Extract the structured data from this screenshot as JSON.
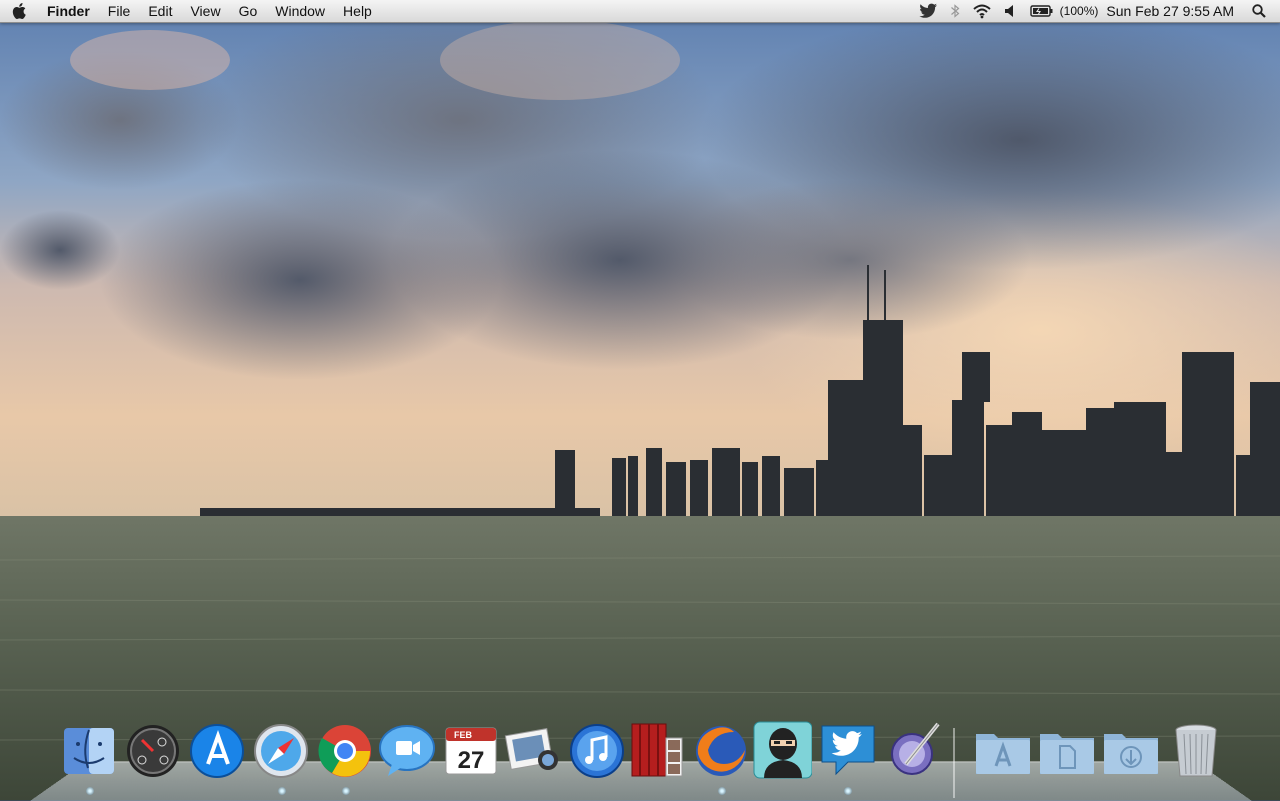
{
  "menubar": {
    "app_name": "Finder",
    "menus": [
      "File",
      "Edit",
      "View",
      "Go",
      "Window",
      "Help"
    ],
    "battery_percent": "(100%)",
    "clock": "Sun Feb 27  9:55 AM",
    "status_icons": [
      "twitter-bird-icon",
      "bluetooth-icon",
      "wifi-icon",
      "volume-icon",
      "battery-icon",
      "spotlight-icon"
    ]
  },
  "desktop": {
    "wallpaper": "city-skyline-over-lake"
  },
  "dock": {
    "apps": [
      "Finder",
      "Dashboard",
      "App Store",
      "Safari",
      "Google Chrome",
      "iChat",
      "iCal",
      "iPhoto",
      "iTunes",
      "Photo Booth",
      "Firefox",
      "Ninja",
      "Twitter",
      "Instruments"
    ],
    "calendar_month": "FEB",
    "calendar_day": "27",
    "stacks": [
      "Applications",
      "Documents",
      "Downloads"
    ],
    "trash": "Trash"
  },
  "colors": {
    "menubar_top": "#f4f4f4",
    "menubar_bottom": "#d9d9d9",
    "accent_blue": "#1a84e8"
  }
}
